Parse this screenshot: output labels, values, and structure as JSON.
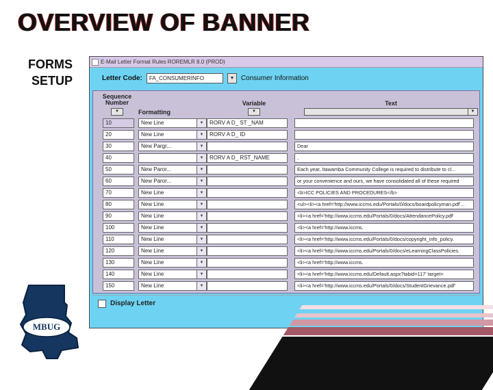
{
  "slide": {
    "title": "OVERVIEW OF BANNER",
    "left_label_line1": "FORMS",
    "left_label_line2": "SETUP"
  },
  "app": {
    "window_title": "E-Mail Letter Format Rules  ROREMLR  8.0  (PROD)",
    "letter_code_label": "Letter Code:",
    "letter_code_value": "FA_CONSUMERINFO",
    "letter_desc": "Consumer Information",
    "columns": {
      "seq": "Sequence Number",
      "fmt": "Formatting",
      "var": "Variable",
      "text": "Text"
    },
    "rows": [
      {
        "seq": "10",
        "fmt": "New Line",
        "var": "RORV A D_ ST _NAM",
        "text": ""
      },
      {
        "seq": "20",
        "fmt": "New Line",
        "var": "RORV A D_ ID",
        "text": ""
      },
      {
        "seq": "30",
        "fmt": "New Pargr...",
        "var": "",
        "text": "Dear"
      },
      {
        "seq": "40",
        "fmt": "",
        "var": "RORV A D_  RST_NAME",
        "text": ","
      },
      {
        "seq": "50",
        "fmt": "New Paror...",
        "var": "",
        "text": "Each year, Itawamba Community College is required to distribute to cl..."
      },
      {
        "seq": "60",
        "fmt": "New Paror...",
        "var": "",
        "text": " or your convenience and ours, we have consolidated all of these required"
      },
      {
        "seq": "70",
        "fmt": "New Line",
        "var": "",
        "text": "<b>ICC POLICIES AND PROCEDURES</b>"
      },
      {
        "seq": "80",
        "fmt": "New Line",
        "var": "",
        "text": "<ul><li><a href='http://www.iccms.edu/Portals/0/docs/boardpolicyman.pdf'..."
      },
      {
        "seq": "90",
        "fmt": "New Line",
        "var": "",
        "text": "<li><a href='http://www.iccms.edu/Portals/0/docs/AttendancePolicy.pdf'"
      },
      {
        "seq": "100",
        "fmt": "New Line",
        "var": "",
        "text": "<li><a href='http://www.iccms."
      },
      {
        "seq": "110",
        "fmt": "New Line",
        "var": "",
        "text": "<li><a href='http://www.iccms.edu/Portals/0/docs/copyright_info_policy."
      },
      {
        "seq": "120",
        "fmt": "New Line",
        "var": "",
        "text": "<li><a href='http://www.iccms.edu/Portals/0/docs/eLearningClassPolicies."
      },
      {
        "seq": "130",
        "fmt": "New Line",
        "var": "",
        "text": "<li><a href='http://www.iccms."
      },
      {
        "seq": "140",
        "fmt": "New Line",
        "var": "",
        "text": "<li><a href='http://www.iccms.edu/Default.aspx?tabid=117' target="
      },
      {
        "seq": "150",
        "fmt": "New Line",
        "var": "",
        "text": "<li><a href='http://www.iccms.edu/Portals/0/docs/StudentGrievance.pdf'"
      }
    ],
    "display_label": "Display Letter"
  },
  "logo": {
    "badge_text": "MBUG"
  }
}
